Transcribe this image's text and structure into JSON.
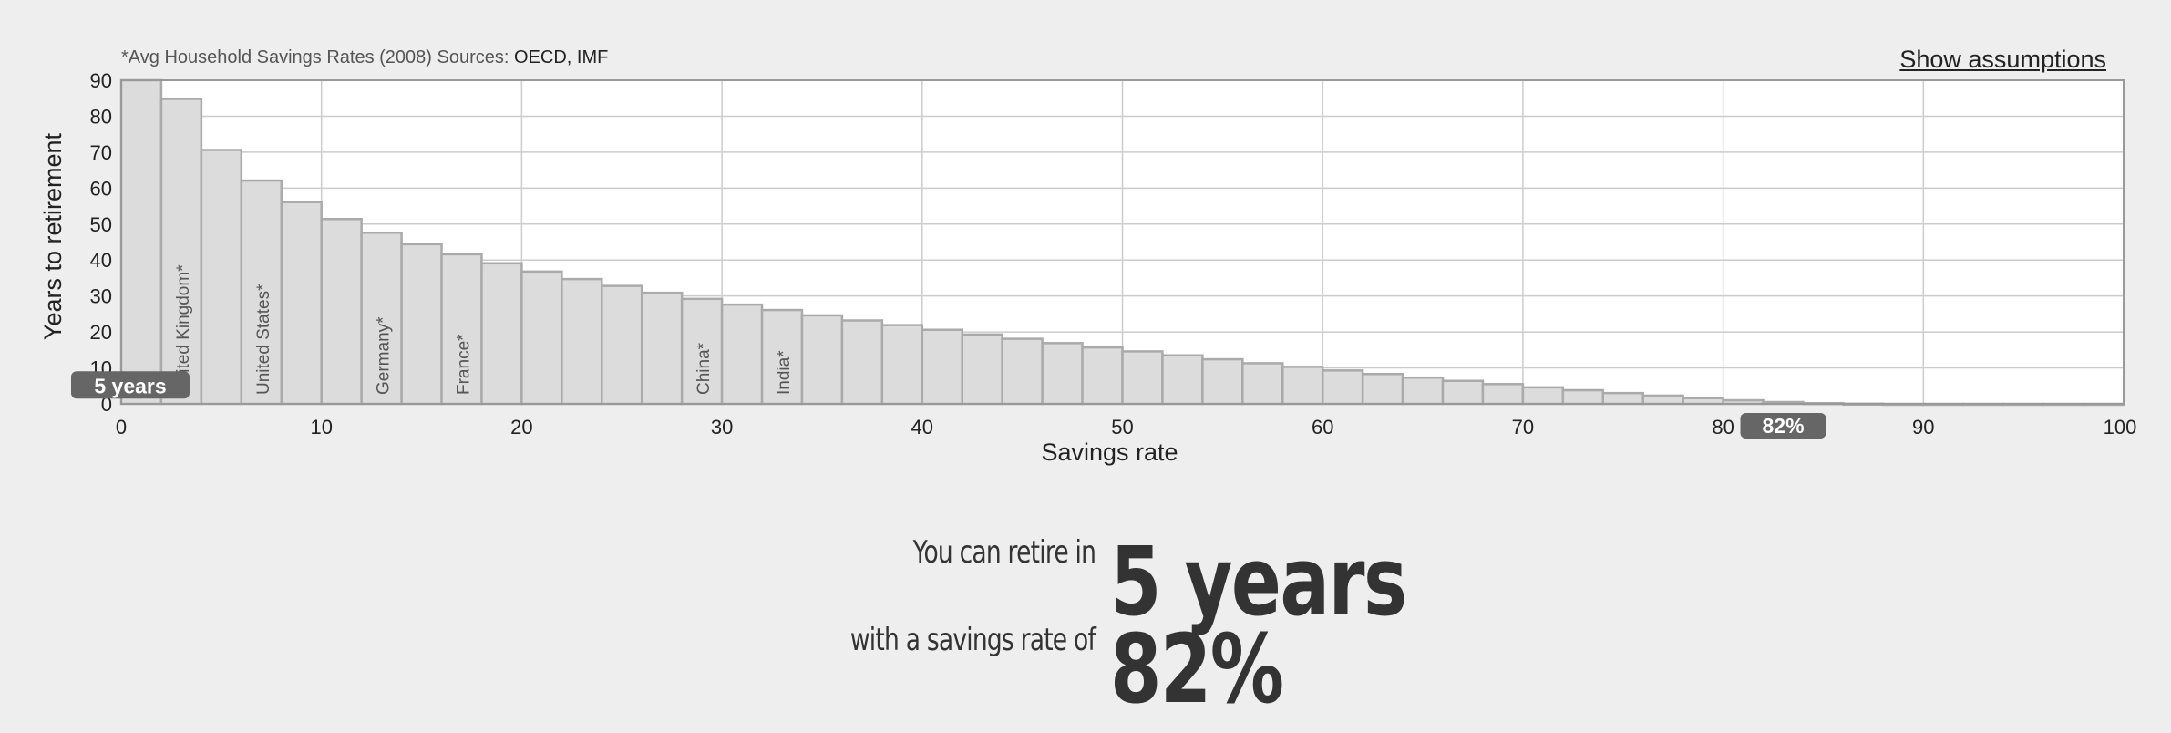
{
  "header": {
    "sources_prefix": "*Avg Household Savings Rates (2008) Sources: ",
    "sources_links": "OECD, IMF",
    "assumptions_label": "Show assumptions"
  },
  "chart_data": {
    "type": "bar",
    "xlabel": "Savings rate",
    "ylabel": "Years to retirement",
    "xlim": [
      0,
      100
    ],
    "ylim": [
      0,
      90
    ],
    "x_ticks": [
      0,
      10,
      20,
      30,
      40,
      50,
      60,
      70,
      80,
      90,
      100
    ],
    "y_ticks": [
      0,
      10,
      20,
      30,
      40,
      50,
      60,
      70,
      80,
      90
    ],
    "bin_width": 2,
    "x": [
      0,
      2,
      4,
      6,
      8,
      10,
      12,
      14,
      16,
      18,
      20,
      22,
      24,
      26,
      28,
      30,
      32,
      34,
      36,
      38,
      40,
      42,
      44,
      46,
      48,
      50,
      52,
      54,
      56,
      58,
      60,
      62,
      64,
      66,
      68,
      70,
      72,
      74,
      76,
      78,
      80,
      82,
      84,
      86,
      88,
      90,
      92,
      94,
      96,
      98
    ],
    "values": [
      90,
      84.8,
      70.6,
      62.1,
      56.1,
      51.4,
      47.6,
      44.4,
      41.6,
      39.1,
      36.8,
      34.7,
      32.8,
      30.9,
      29.2,
      27.6,
      26.1,
      24.6,
      23.2,
      21.9,
      20.6,
      19.3,
      18.1,
      16.9,
      15.7,
      14.6,
      13.5,
      12.4,
      11.3,
      10.3,
      9.3,
      8.3,
      7.3,
      6.4,
      5.5,
      4.6,
      3.8,
      3.0,
      2.3,
      1.6,
      1.0,
      0.5,
      0.2,
      0.05,
      0.0,
      0.0,
      0.0,
      0.0,
      0.0,
      0.0
    ],
    "highlight_x": 82,
    "highlight_color": "#a3cc72",
    "bar_color": "#dcdcdc",
    "bar_border_color": "#aaaaaa",
    "grid": true,
    "country_labels": [
      {
        "label": "United Kingdom*",
        "x": 2
      },
      {
        "label": "United States*",
        "x": 6
      },
      {
        "label": "Germany*",
        "x": 12
      },
      {
        "label": "France*",
        "x": 16
      },
      {
        "label": "China*",
        "x": 28
      },
      {
        "label": "India*",
        "x": 32
      }
    ],
    "y_marker_label": "5 years",
    "y_marker_value": 5,
    "x_marker_label": "82%",
    "x_marker_value": 82,
    "marker_color": "#666666"
  },
  "result": {
    "line1_prefix": "You can retire in",
    "line1_value": "5 years",
    "line2_prefix": "with a savings rate of",
    "line2_value": "82%"
  }
}
